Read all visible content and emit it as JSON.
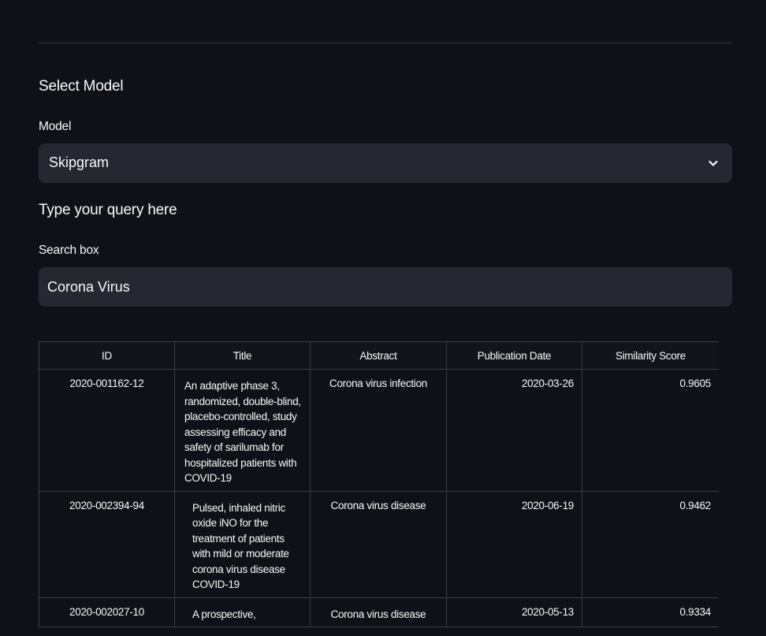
{
  "model_section": {
    "heading": "Select Model",
    "label": "Model",
    "selected": "Skipgram"
  },
  "query_section": {
    "heading": "Type your query here",
    "label": "Search box",
    "value": "Corona Virus"
  },
  "results_table": {
    "columns": [
      "ID",
      "Title",
      "Abstract",
      "Publication Date",
      "Similarity Score"
    ],
    "rows": [
      {
        "id": "2020-001162-12",
        "title": "An adaptive phase 3, randomized, double-blind, placebo-controlled, study assessing efficacy and safety of sarilumab for hospitalized patients with COVID-19",
        "abstract": "Corona virus infection",
        "date": "2020-03-26",
        "score": "0.9605"
      },
      {
        "id": "2020-002394-94",
        "title": "Pulsed, inhaled nitric oxide iNO for the treatment of patients with mild or moderate corona virus disease COVID-19",
        "abstract": "Corona virus disease",
        "date": "2020-06-19",
        "score": "0.9462"
      },
      {
        "id": "2020-002027-10",
        "title": "A prospective,",
        "abstract": "Corona virus disease",
        "date": "2020-05-13",
        "score": "0.9334"
      }
    ]
  },
  "colors": {
    "background": "#0e1117",
    "input_bg": "#262730",
    "text": "#fafafa",
    "border": "#3a3d47"
  },
  "icons": {
    "select_chevron": "chevron-down-icon"
  }
}
